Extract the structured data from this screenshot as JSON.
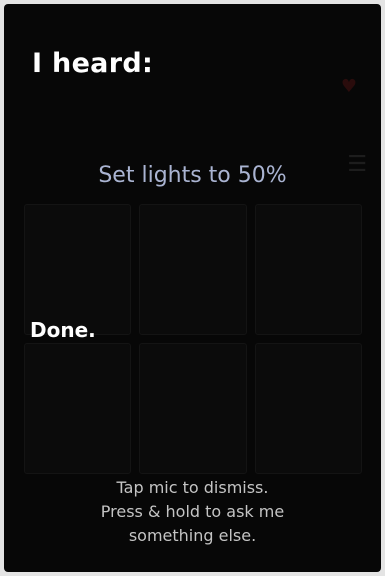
{
  "overlay": {
    "heading": "I heard:",
    "command": "Set lights to 50%",
    "status": "Done.",
    "instructions": [
      "Tap mic to dismiss.",
      "Press & hold to ask me",
      "something else."
    ]
  },
  "colors": {
    "background": "#070707",
    "command_text": "#aab4d2",
    "heading_text": "#ffffff",
    "instruction_text": "#c4c4c4"
  }
}
